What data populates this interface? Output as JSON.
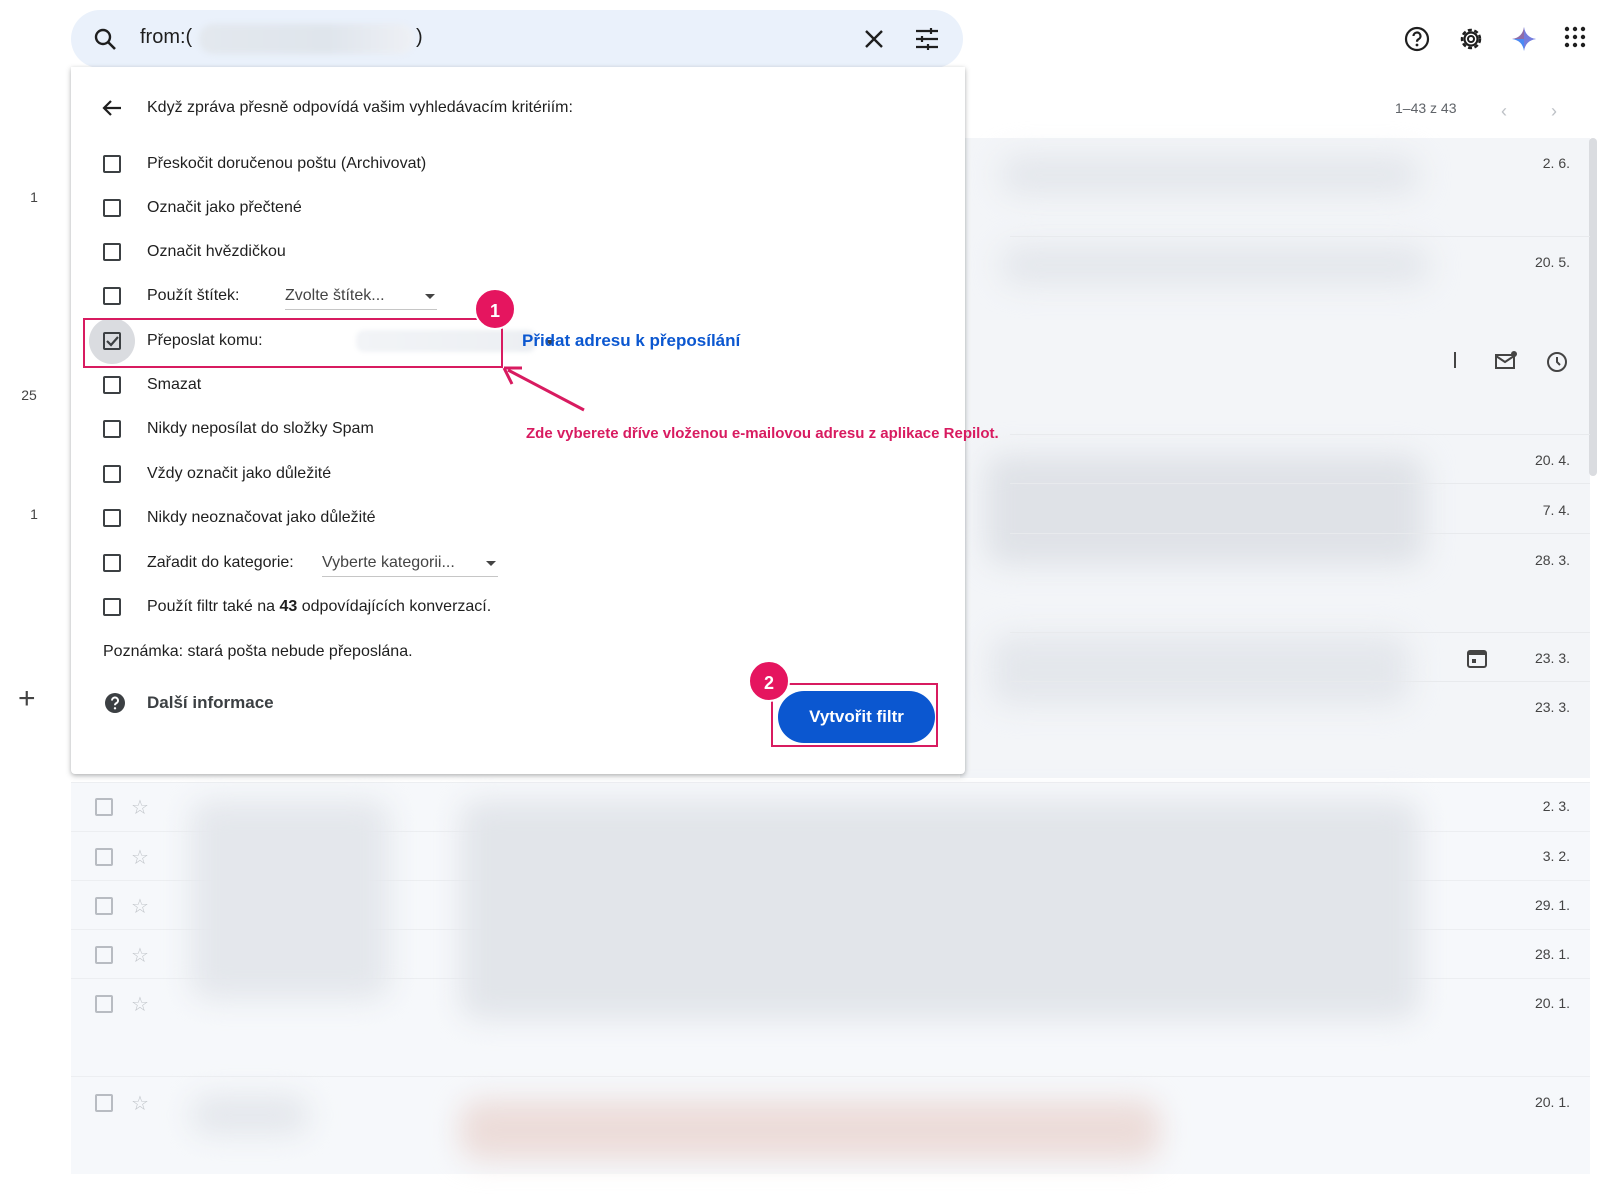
{
  "search": {
    "query_prefix": "from:(",
    "query_suffix": ")"
  },
  "rail": {
    "counts": [
      "1",
      "25",
      "1"
    ],
    "compose_label": "+"
  },
  "pager": {
    "range_text": "1–43 z 43"
  },
  "list": {
    "dates": [
      "2. 6.",
      "20. 5.",
      "20. 4.",
      "7. 4.",
      "28. 3.",
      "23. 3.",
      "23. 3."
    ],
    "lower_dates": [
      "2. 3.",
      "3. 2.",
      "29. 1.",
      "28. 1.",
      "20. 1.",
      "20. 1."
    ]
  },
  "dialog": {
    "title": "Když zpráva přesně odpovídá vašim vyhledávacím kritériím:",
    "options": {
      "archive": "Přeskočit doručenou poštu (Archivovat)",
      "mark_read": "Označit jako přečtené",
      "star": "Označit hvězdičkou",
      "label": "Použít štítek:",
      "label_select": "Zvolte štítek...",
      "forward": "Přeposlat komu:",
      "delete": "Smazat",
      "never_spam": "Nikdy neposílat do složky Spam",
      "always_important": "Vždy označit jako důležité",
      "never_important": "Nikdy neoznačovat jako důležité",
      "category": "Zařadit do kategorie:",
      "category_select": "Vyberte kategorii...",
      "apply_prefix": "Použít filtr také na ",
      "apply_count": "43",
      "apply_suffix": " odpovídajících konverzací."
    },
    "forward_link": "Přidat adresu k přeposílání",
    "note": "Poznámka: stará pošta nebude přeposlána.",
    "more_info": "Další informace",
    "create_button": "Vytvořit filtr"
  },
  "annotations": {
    "badge1": "1",
    "badge2": "2",
    "callout": "Zde vyberete dříve vloženou e-mailovou adresu z aplikace Repilot.",
    "color": "#d81b60"
  },
  "icons": [
    "search-icon",
    "close-icon",
    "tune-icon",
    "help-icon",
    "settings-icon",
    "gemini-icon",
    "apps-grid-icon",
    "back-arrow-icon",
    "mark-unread-icon",
    "snooze-icon",
    "calendar-icon",
    "star-icon",
    "checkbox-icon"
  ]
}
